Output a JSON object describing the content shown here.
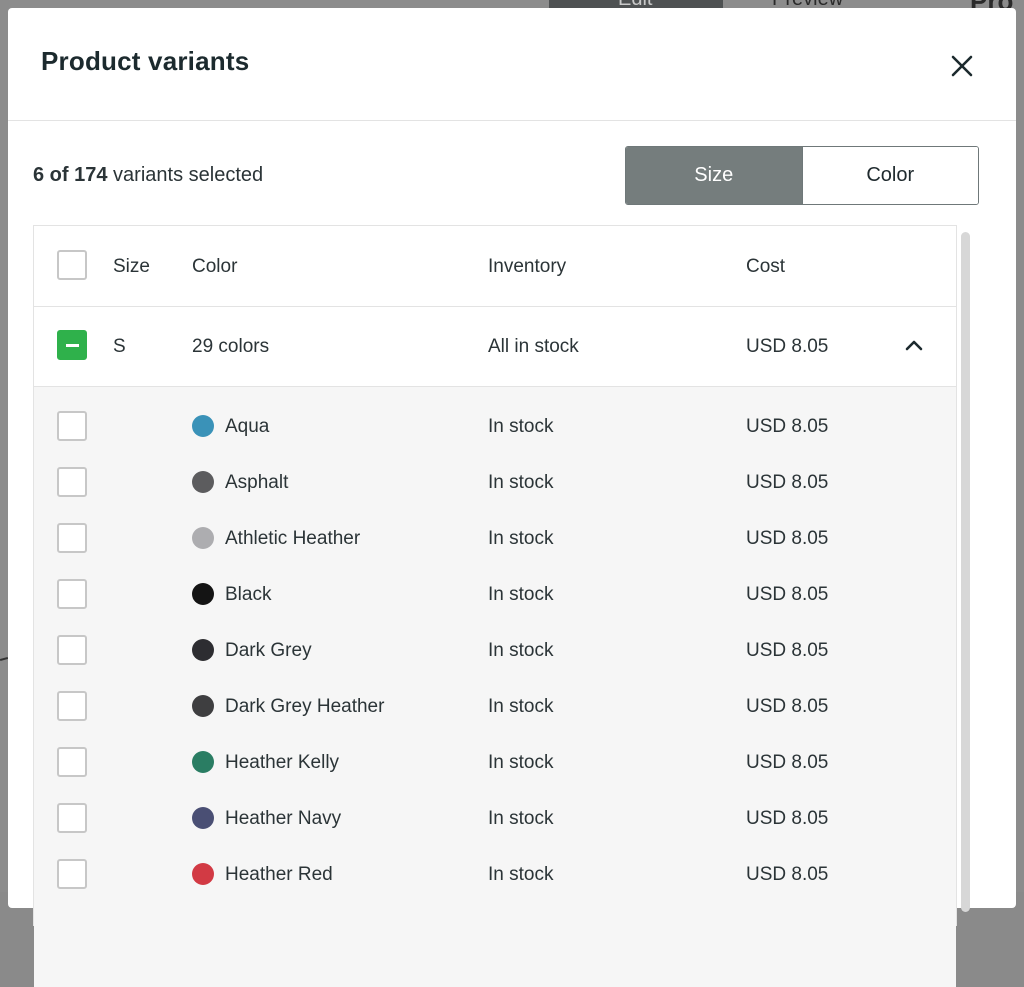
{
  "background": {
    "tab_edit": "Edit",
    "tab_preview": "Preview",
    "heading": "Pro"
  },
  "modal": {
    "title": "Product variants",
    "close_icon": "close-icon"
  },
  "toolbar": {
    "selected_count": "6 of 174",
    "selected_suffix": " variants selected",
    "group_by": {
      "size_label": "Size",
      "color_label": "Color",
      "active": "Size"
    }
  },
  "table": {
    "headers": {
      "size": "Size",
      "color": "Color",
      "inventory": "Inventory",
      "cost": "Cost"
    },
    "group": {
      "size": "S",
      "colors": "29 colors",
      "inventory": "All in stock",
      "cost": "USD 8.05",
      "expanded": true
    },
    "rows": [
      {
        "color": "Aqua",
        "swatch": "#3a92b8",
        "inventory": "In stock",
        "cost": "USD 8.05"
      },
      {
        "color": "Asphalt",
        "swatch": "#5c5c5e",
        "inventory": "In stock",
        "cost": "USD 8.05"
      },
      {
        "color": "Athletic Heather",
        "swatch": "#adadb0",
        "inventory": "In stock",
        "cost": "USD 8.05"
      },
      {
        "color": "Black",
        "swatch": "#141414",
        "inventory": "In stock",
        "cost": "USD 8.05"
      },
      {
        "color": "Dark Grey",
        "swatch": "#2d2d31",
        "inventory": "In stock",
        "cost": "USD 8.05"
      },
      {
        "color": "Dark Grey Heather",
        "swatch": "#3e3e40",
        "inventory": "In stock",
        "cost": "USD 8.05"
      },
      {
        "color": "Heather Kelly",
        "swatch": "#2a7d63",
        "inventory": "In stock",
        "cost": "USD 8.05"
      },
      {
        "color": "Heather Navy",
        "swatch": "#4a4f74",
        "inventory": "In stock",
        "cost": "USD 8.05"
      },
      {
        "color": "Heather Red",
        "swatch": "#d23a44",
        "inventory": "In stock",
        "cost": "USD 8.05"
      }
    ]
  },
  "colors": {
    "accent_green": "#2fb14b",
    "segment_active": "#757d7d"
  }
}
